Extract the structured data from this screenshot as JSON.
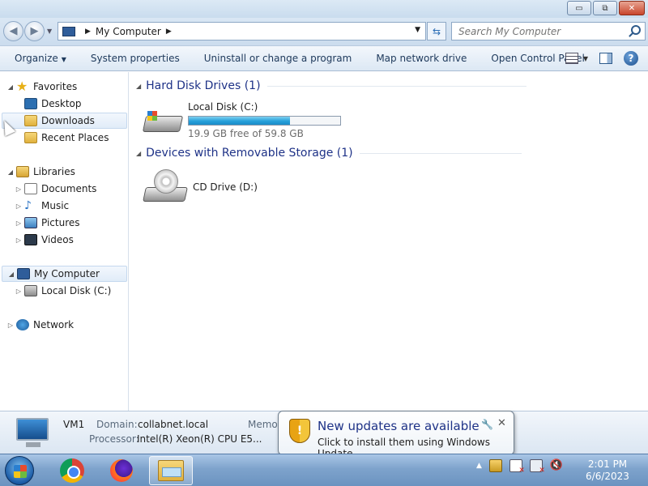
{
  "window": {
    "minimize": "▭",
    "maximize": "⧉",
    "close": "✕"
  },
  "address": {
    "path": "My Computer",
    "search_placeholder": "Search My Computer"
  },
  "toolbar": {
    "organize": "Organize",
    "system_properties": "System properties",
    "uninstall": "Uninstall or change a program",
    "map_drive": "Map network drive",
    "control_panel": "Open Control Panel",
    "help": "?"
  },
  "nav": {
    "favorites": "Favorites",
    "desktop": "Desktop",
    "downloads": "Downloads",
    "recent_places": "Recent Places",
    "libraries": "Libraries",
    "documents": "Documents",
    "music": "Music",
    "pictures": "Pictures",
    "videos": "Videos",
    "my_computer": "My Computer",
    "local_disk": "Local Disk (C:)",
    "network": "Network"
  },
  "content": {
    "hdd_group": "Hard Disk Drives (1)",
    "removable_group": "Devices with Removable Storage (1)",
    "local_disk_name": "Local Disk (C:)",
    "local_disk_free": "19.9 GB free of 59.8 GB",
    "local_disk_used_fraction": 0.667,
    "cd_drive_name": "CD Drive (D:)"
  },
  "details": {
    "computer_name": "VM1",
    "domain_key": "Domain:",
    "domain_val": "collabnet.local",
    "processor_key": "Processor:",
    "processor_val": "Intel(R) Xeon(R) CPU E5...",
    "memory_key": "Memo"
  },
  "balloon": {
    "title": "New updates are available",
    "text": "Click to install them using Windows Update.",
    "close": "✕",
    "wrench": "🔧"
  },
  "taskbar": {
    "time": "2:01 PM",
    "date": "6/6/2023"
  },
  "colors": {
    "accent": "#26a0da",
    "group_title": "#1e3287"
  }
}
